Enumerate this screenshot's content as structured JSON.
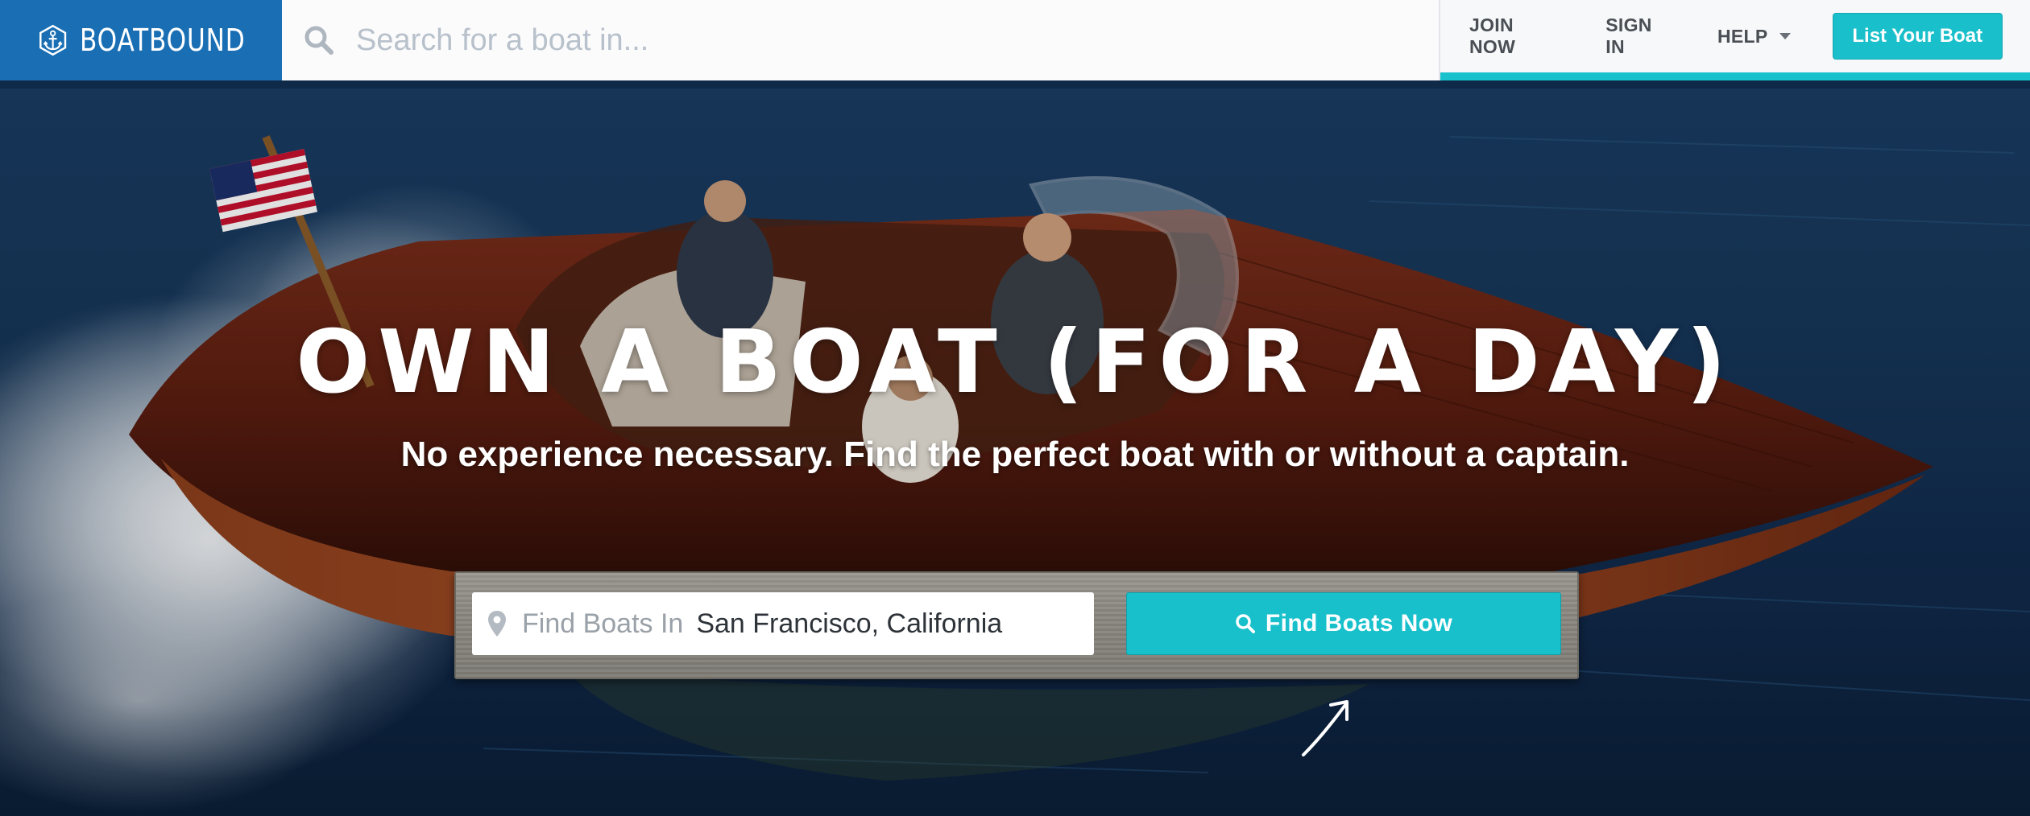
{
  "brand": {
    "name": "BOATBOUND"
  },
  "header": {
    "search": {
      "placeholder": "Search for a boat in..."
    },
    "nav": {
      "join": "JOIN NOW",
      "signin": "SIGN IN",
      "help": "HELP"
    },
    "cta": "List Your Boat"
  },
  "hero": {
    "headline": "OWN A BOAT (FOR A DAY)",
    "subhead": "No experience necessary. Find the perfect boat with or without a captain.",
    "search_panel": {
      "label": "Find Boats In",
      "location": "San Francisco, California",
      "button": "Find Boats Now"
    }
  },
  "colors": {
    "brand_blue": "#1a6fb4",
    "accent_teal": "#19c1cc",
    "nav_text": "#4a4f55"
  },
  "icons": [
    "anchor-icon",
    "search-icon",
    "chevron-down-icon",
    "map-pin-icon",
    "arrow-doodle-icon"
  ]
}
